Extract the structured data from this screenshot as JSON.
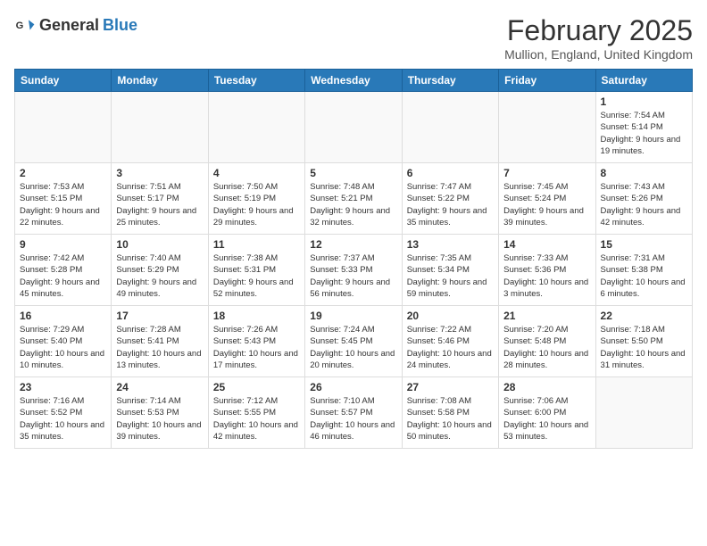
{
  "header": {
    "logo_general": "General",
    "logo_blue": "Blue",
    "month_title": "February 2025",
    "location": "Mullion, England, United Kingdom"
  },
  "days_of_week": [
    "Sunday",
    "Monday",
    "Tuesday",
    "Wednesday",
    "Thursday",
    "Friday",
    "Saturday"
  ],
  "weeks": [
    [
      {
        "day": "",
        "info": ""
      },
      {
        "day": "",
        "info": ""
      },
      {
        "day": "",
        "info": ""
      },
      {
        "day": "",
        "info": ""
      },
      {
        "day": "",
        "info": ""
      },
      {
        "day": "",
        "info": ""
      },
      {
        "day": "1",
        "info": "Sunrise: 7:54 AM\nSunset: 5:14 PM\nDaylight: 9 hours and 19 minutes."
      }
    ],
    [
      {
        "day": "2",
        "info": "Sunrise: 7:53 AM\nSunset: 5:15 PM\nDaylight: 9 hours and 22 minutes."
      },
      {
        "day": "3",
        "info": "Sunrise: 7:51 AM\nSunset: 5:17 PM\nDaylight: 9 hours and 25 minutes."
      },
      {
        "day": "4",
        "info": "Sunrise: 7:50 AM\nSunset: 5:19 PM\nDaylight: 9 hours and 29 minutes."
      },
      {
        "day": "5",
        "info": "Sunrise: 7:48 AM\nSunset: 5:21 PM\nDaylight: 9 hours and 32 minutes."
      },
      {
        "day": "6",
        "info": "Sunrise: 7:47 AM\nSunset: 5:22 PM\nDaylight: 9 hours and 35 minutes."
      },
      {
        "day": "7",
        "info": "Sunrise: 7:45 AM\nSunset: 5:24 PM\nDaylight: 9 hours and 39 minutes."
      },
      {
        "day": "8",
        "info": "Sunrise: 7:43 AM\nSunset: 5:26 PM\nDaylight: 9 hours and 42 minutes."
      }
    ],
    [
      {
        "day": "9",
        "info": "Sunrise: 7:42 AM\nSunset: 5:28 PM\nDaylight: 9 hours and 45 minutes."
      },
      {
        "day": "10",
        "info": "Sunrise: 7:40 AM\nSunset: 5:29 PM\nDaylight: 9 hours and 49 minutes."
      },
      {
        "day": "11",
        "info": "Sunrise: 7:38 AM\nSunset: 5:31 PM\nDaylight: 9 hours and 52 minutes."
      },
      {
        "day": "12",
        "info": "Sunrise: 7:37 AM\nSunset: 5:33 PM\nDaylight: 9 hours and 56 minutes."
      },
      {
        "day": "13",
        "info": "Sunrise: 7:35 AM\nSunset: 5:34 PM\nDaylight: 9 hours and 59 minutes."
      },
      {
        "day": "14",
        "info": "Sunrise: 7:33 AM\nSunset: 5:36 PM\nDaylight: 10 hours and 3 minutes."
      },
      {
        "day": "15",
        "info": "Sunrise: 7:31 AM\nSunset: 5:38 PM\nDaylight: 10 hours and 6 minutes."
      }
    ],
    [
      {
        "day": "16",
        "info": "Sunrise: 7:29 AM\nSunset: 5:40 PM\nDaylight: 10 hours and 10 minutes."
      },
      {
        "day": "17",
        "info": "Sunrise: 7:28 AM\nSunset: 5:41 PM\nDaylight: 10 hours and 13 minutes."
      },
      {
        "day": "18",
        "info": "Sunrise: 7:26 AM\nSunset: 5:43 PM\nDaylight: 10 hours and 17 minutes."
      },
      {
        "day": "19",
        "info": "Sunrise: 7:24 AM\nSunset: 5:45 PM\nDaylight: 10 hours and 20 minutes."
      },
      {
        "day": "20",
        "info": "Sunrise: 7:22 AM\nSunset: 5:46 PM\nDaylight: 10 hours and 24 minutes."
      },
      {
        "day": "21",
        "info": "Sunrise: 7:20 AM\nSunset: 5:48 PM\nDaylight: 10 hours and 28 minutes."
      },
      {
        "day": "22",
        "info": "Sunrise: 7:18 AM\nSunset: 5:50 PM\nDaylight: 10 hours and 31 minutes."
      }
    ],
    [
      {
        "day": "23",
        "info": "Sunrise: 7:16 AM\nSunset: 5:52 PM\nDaylight: 10 hours and 35 minutes."
      },
      {
        "day": "24",
        "info": "Sunrise: 7:14 AM\nSunset: 5:53 PM\nDaylight: 10 hours and 39 minutes."
      },
      {
        "day": "25",
        "info": "Sunrise: 7:12 AM\nSunset: 5:55 PM\nDaylight: 10 hours and 42 minutes."
      },
      {
        "day": "26",
        "info": "Sunrise: 7:10 AM\nSunset: 5:57 PM\nDaylight: 10 hours and 46 minutes."
      },
      {
        "day": "27",
        "info": "Sunrise: 7:08 AM\nSunset: 5:58 PM\nDaylight: 10 hours and 50 minutes."
      },
      {
        "day": "28",
        "info": "Sunrise: 7:06 AM\nSunset: 6:00 PM\nDaylight: 10 hours and 53 minutes."
      },
      {
        "day": "",
        "info": ""
      }
    ]
  ]
}
